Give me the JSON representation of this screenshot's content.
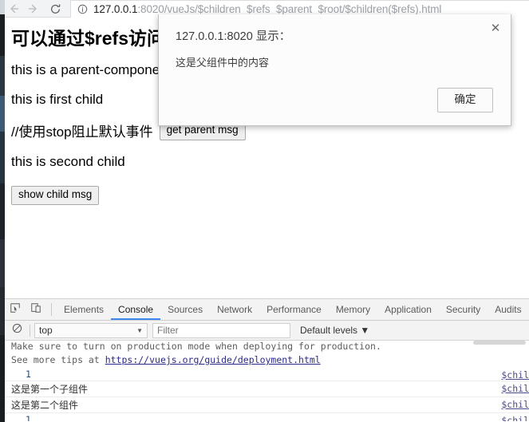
{
  "browser": {
    "nav": {
      "back_label": "Back",
      "forward_label": "Forward",
      "reload_label": "Reload"
    },
    "omnibox": {
      "info_icon": "info-circle-icon",
      "url_host": "127.0.0.1",
      "url_rest": ":8020/vueJs/$children_$refs_$parent_$root/$children($refs).html",
      "url_full": "127.0.0.1:8020/vueJs/$children_$refs_$parent_$root/$children($refs).html"
    }
  },
  "page": {
    "heading": "可以通过$refs访问父组件",
    "para_parent": "this is a parent-component",
    "para_first_child": "this is first child",
    "comment_stop": "//使用stop阻止默认事件",
    "get_parent_button": "get parent msg",
    "para_second_child": "this is second child",
    "show_child_button": "show child msg"
  },
  "dialog": {
    "title": "127.0.0.1:8020 显示：",
    "message": "这是父组件中的内容",
    "ok_label": "确定",
    "close_icon": "close-icon",
    "close_glyph": "✕"
  },
  "devtools": {
    "icons": {
      "inspect": "inspect-element-icon",
      "device": "device-toolbar-icon",
      "clear": "clear-console-icon"
    },
    "tabs": [
      {
        "label": "Elements",
        "active": false
      },
      {
        "label": "Console",
        "active": true
      },
      {
        "label": "Sources",
        "active": false
      },
      {
        "label": "Network",
        "active": false
      },
      {
        "label": "Performance",
        "active": false
      },
      {
        "label": "Memory",
        "active": false
      },
      {
        "label": "Application",
        "active": false
      },
      {
        "label": "Security",
        "active": false
      },
      {
        "label": "Audits",
        "active": false
      }
    ],
    "filterbar": {
      "context_value": "top",
      "context_caret": "▼",
      "filter_placeholder": "Filter",
      "levels_label": "Default levels ▼"
    },
    "console_rows": [
      {
        "kind": "warn-tail",
        "text": "Make sure to turn on production mode when deploying for production.",
        "link": ""
      },
      {
        "kind": "warn-tail-link",
        "prefix": "See more tips at ",
        "linktext": "https://vuejs.org/guide/deployment.html",
        "link": ""
      },
      {
        "kind": "num",
        "text": "1",
        "link": "$chil"
      },
      {
        "kind": "cjk",
        "text": "这是第一个子组件",
        "link": "$chil"
      },
      {
        "kind": "cjk",
        "text": "这是第二个组件",
        "link": "$chil"
      },
      {
        "kind": "num",
        "text": "1",
        "link": "$chil"
      }
    ]
  },
  "colors": {
    "accent": "#4285f4",
    "toolbar_bg": "#f1f3f4",
    "devtools_bg": "#f3f3f3",
    "page_bg": "#ffffff",
    "link": "#2a2a8a"
  }
}
